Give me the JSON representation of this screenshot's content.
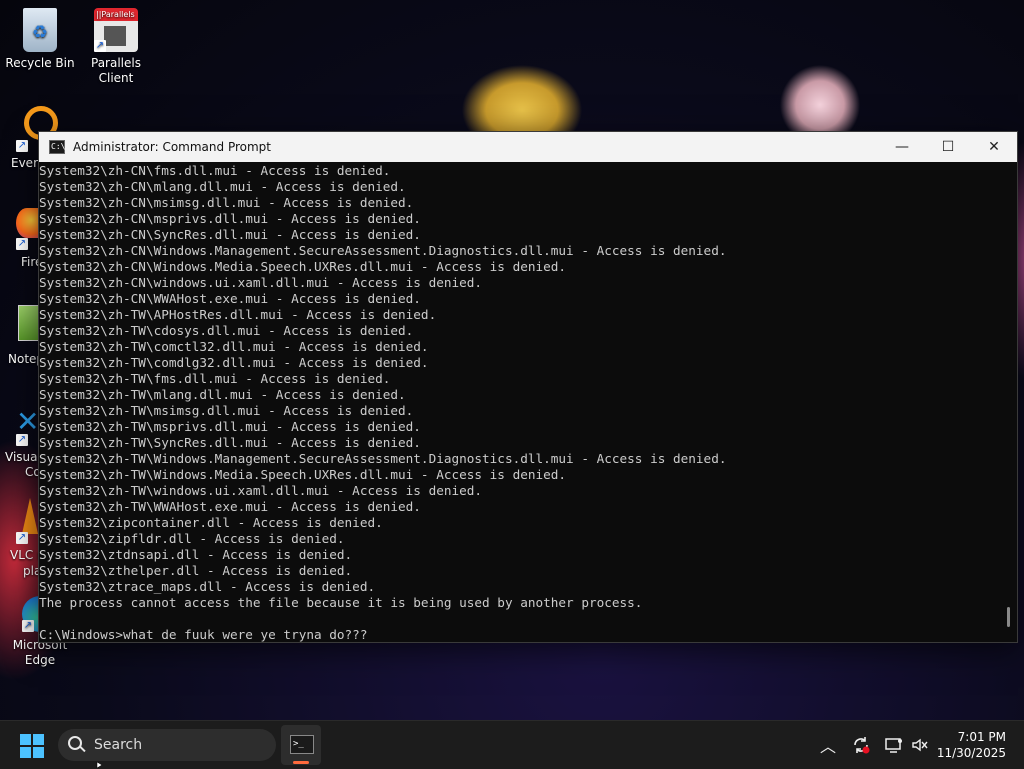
{
  "desktop": {
    "icons": [
      {
        "label": "Recycle Bin"
      },
      {
        "label": "Parallels Client",
        "line1": "Parallels",
        "line2": "Client",
        "badge": "||Parallels"
      }
    ],
    "partial_labels": [
      "Every",
      "Fire",
      "Notep",
      "Visual",
      "Co",
      "VLC r",
      "pla",
      "Microsoft",
      "Edge"
    ]
  },
  "window": {
    "title": "Administrator: Command Prompt",
    "minimize": "—",
    "maximize": "☐",
    "close": "✕"
  },
  "console": {
    "lines": [
      "System32\\zh-CN\\fms.dll.mui - Access is denied.",
      "System32\\zh-CN\\mlang.dll.mui - Access is denied.",
      "System32\\zh-CN\\msimsg.dll.mui - Access is denied.",
      "System32\\zh-CN\\msprivs.dll.mui - Access is denied.",
      "System32\\zh-CN\\SyncRes.dll.mui - Access is denied.",
      "System32\\zh-CN\\Windows.Management.SecureAssessment.Diagnostics.dll.mui - Access is denied.",
      "System32\\zh-CN\\Windows.Media.Speech.UXRes.dll.mui - Access is denied.",
      "System32\\zh-CN\\windows.ui.xaml.dll.mui - Access is denied.",
      "System32\\zh-CN\\WWAHost.exe.mui - Access is denied.",
      "System32\\zh-TW\\APHostRes.dll.mui - Access is denied.",
      "System32\\zh-TW\\cdosys.dll.mui - Access is denied.",
      "System32\\zh-TW\\comctl32.dll.mui - Access is denied.",
      "System32\\zh-TW\\comdlg32.dll.mui - Access is denied.",
      "System32\\zh-TW\\fms.dll.mui - Access is denied.",
      "System32\\zh-TW\\mlang.dll.mui - Access is denied.",
      "System32\\zh-TW\\msimsg.dll.mui - Access is denied.",
      "System32\\zh-TW\\msprivs.dll.mui - Access is denied.",
      "System32\\zh-TW\\SyncRes.dll.mui - Access is denied.",
      "System32\\zh-TW\\Windows.Management.SecureAssessment.Diagnostics.dll.mui - Access is denied.",
      "System32\\zh-TW\\Windows.Media.Speech.UXRes.dll.mui - Access is denied.",
      "System32\\zh-TW\\windows.ui.xaml.dll.mui - Access is denied.",
      "System32\\zh-TW\\WWAHost.exe.mui - Access is denied.",
      "System32\\zipcontainer.dll - Access is denied.",
      "System32\\zipfldr.dll - Access is denied.",
      "System32\\ztdnsapi.dll - Access is denied.",
      "System32\\zthelper.dll - Access is denied.",
      "System32\\ztrace_maps.dll - Access is denied.",
      "The process cannot access the file because it is being used by another process.",
      "",
      "C:\\Windows>what de fuuk were ye tryna do???"
    ]
  },
  "taskbar": {
    "search_label": "Search",
    "time": "7:01 PM",
    "date": "11/30/2025"
  },
  "colors": {
    "console_bg": "#0c0c0c",
    "console_fg": "#cccccc",
    "accent": "#4cc2ff",
    "active_indicator": "#ff6a3d"
  }
}
